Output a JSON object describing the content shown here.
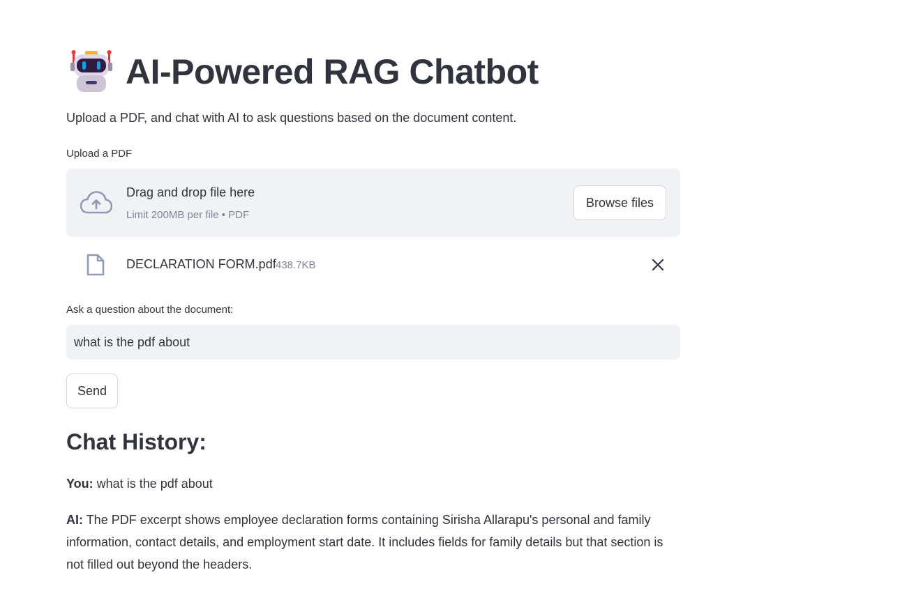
{
  "header": {
    "icon": "robot-icon",
    "title": "AI-Powered RAG Chatbot",
    "subtitle": "Upload a PDF, and chat with AI to ask questions based on the document content."
  },
  "uploader": {
    "label": "Upload a PDF",
    "drop_title": "Drag and drop file here",
    "drop_limit": "Limit 200MB per file • PDF",
    "browse_label": "Browse files",
    "icon": "cloud-upload-icon"
  },
  "uploaded_file": {
    "name": "DECLARATION FORM.pdf",
    "size": "438.7KB",
    "icon": "file-icon",
    "remove_icon": "close-icon"
  },
  "question": {
    "label": "Ask a question about the document:",
    "value": "what is the pdf about",
    "send_label": "Send"
  },
  "chat_history": {
    "heading": "Chat History:",
    "messages": [
      {
        "speaker": "You:",
        "text": "what is the pdf about"
      },
      {
        "speaker": "AI:",
        "text": "The PDF excerpt shows employee declaration forms containing Sirisha Allarapu's personal and family information, contact details, and employment start date. It includes fields for family details but that section is not filled out beyond the headers."
      }
    ]
  },
  "colors": {
    "text": "#31333f",
    "muted_text": "#808495",
    "panel_bg": "#f0f2f6",
    "border": "#d6d6d9"
  }
}
